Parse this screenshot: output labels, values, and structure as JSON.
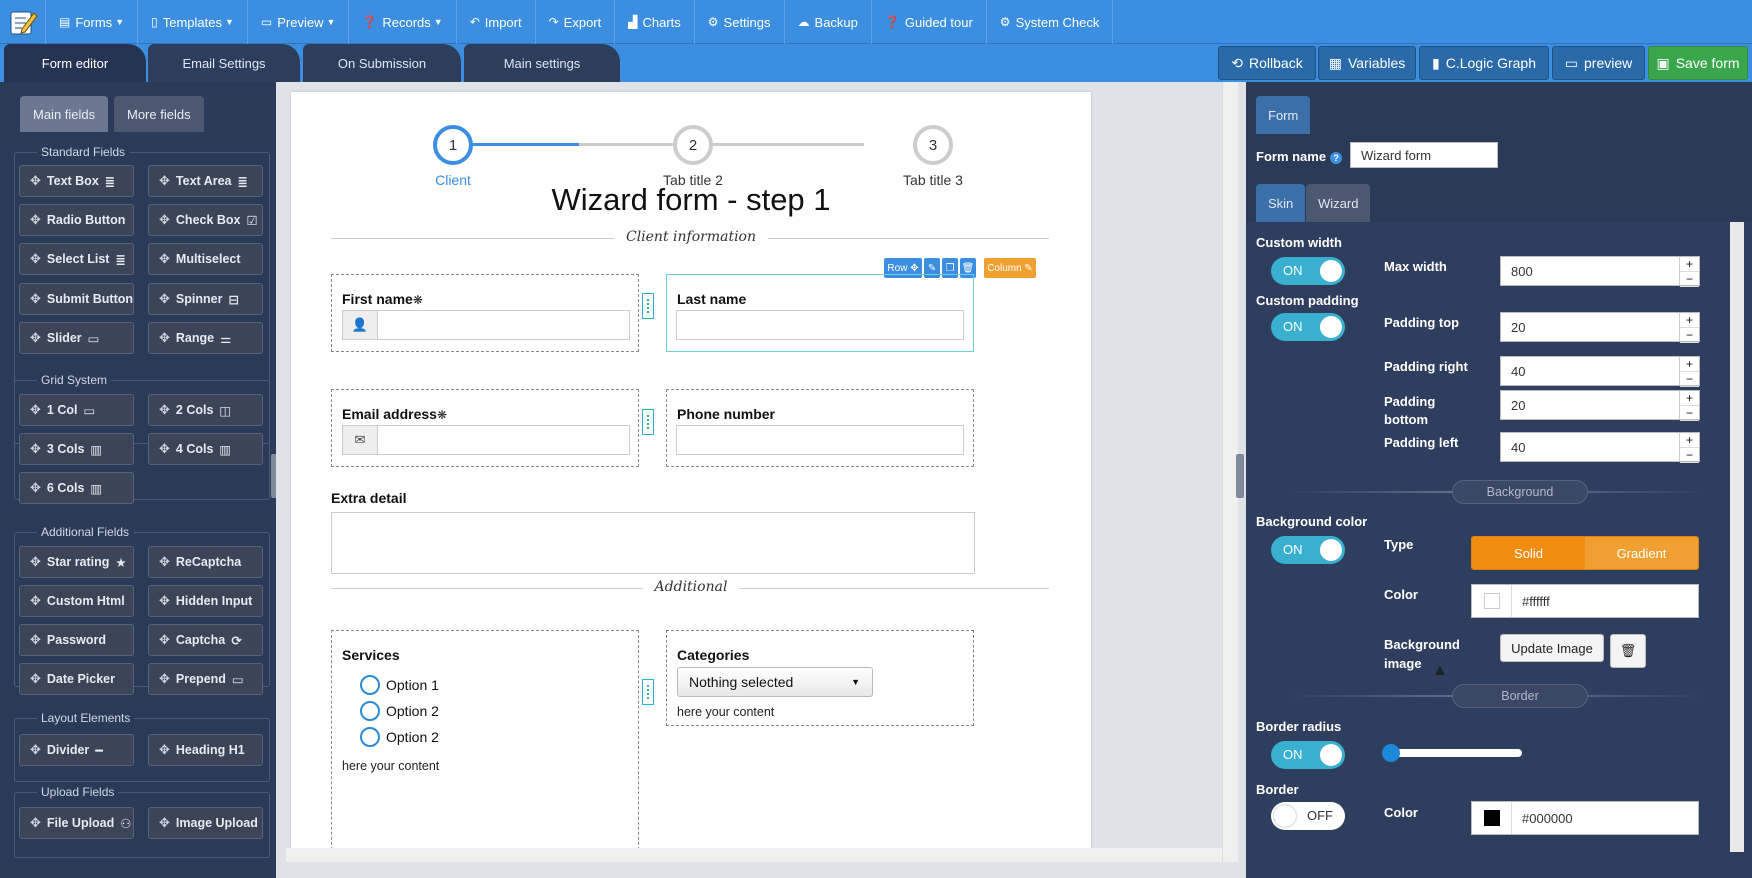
{
  "topnav": {
    "items": [
      {
        "label": "Forms",
        "icon": "file-icon",
        "caret": true
      },
      {
        "label": "Templates",
        "icon": "template-icon",
        "caret": true
      },
      {
        "label": "Preview",
        "icon": "monitor-icon",
        "caret": true
      },
      {
        "label": "Records",
        "icon": "question-icon",
        "caret": true
      },
      {
        "label": "Import",
        "icon": "undo-icon",
        "caret": false
      },
      {
        "label": "Export",
        "icon": "share-icon",
        "caret": false
      },
      {
        "label": "Charts",
        "icon": "chart-icon",
        "caret": false
      },
      {
        "label": "Settings",
        "icon": "gear-icon",
        "caret": false
      },
      {
        "label": "Backup",
        "icon": "cloud-icon",
        "caret": false
      },
      {
        "label": "Guided tour",
        "icon": "question-icon",
        "caret": false
      },
      {
        "label": "System Check",
        "icon": "gear-icon",
        "caret": false
      }
    ]
  },
  "editor_tabs": [
    "Form editor",
    "Email Settings",
    "On Submission",
    "Main settings"
  ],
  "actions": {
    "rollback": "Rollback",
    "variables": "Variables",
    "clogic": "C.Logic Graph",
    "preview": "preview",
    "save": "Save form"
  },
  "left": {
    "tabs": [
      "Main fields",
      "More fields"
    ],
    "groups": {
      "standard": {
        "caption": "Standard Fields",
        "items": [
          "Text Box",
          "Text Area",
          "Radio Button",
          "Check Box",
          "Select List",
          "Multiselect",
          "Submit Button",
          "Spinner",
          "Slider",
          "Range"
        ]
      },
      "grid": {
        "caption": "Grid System",
        "items": [
          "1 Col",
          "2 Cols",
          "3 Cols",
          "4 Cols",
          "6 Cols"
        ]
      },
      "additional": {
        "caption": "Additional Fields",
        "items": [
          "Star rating",
          "ReCaptcha",
          "Custom Html",
          "Hidden Input",
          "Password",
          "Captcha",
          "Date Picker",
          "Prepend"
        ]
      },
      "layout": {
        "caption": "Layout Elements",
        "items": [
          "Divider",
          "Heading H1"
        ]
      },
      "upload": {
        "caption": "Upload Fields",
        "items": [
          "File Upload",
          "Image Upload"
        ]
      }
    }
  },
  "form": {
    "steps": [
      {
        "num": "1",
        "label": "Client"
      },
      {
        "num": "2",
        "label": "Tab title 2"
      },
      {
        "num": "3",
        "label": "Tab title 3"
      }
    ],
    "title": "Wizard form - step 1",
    "div1": "Client information",
    "first_name": "First name",
    "last_name": "Last name",
    "email": "Email address",
    "phone": "Phone number",
    "extra": "Extra detail",
    "div2": "Additional",
    "services": "Services",
    "options": [
      "Option 1",
      "Option 2",
      "Option 2"
    ],
    "services_help": "here your content",
    "categories": "Categories",
    "categories_value": "Nothing selected",
    "categories_help": "here your content",
    "row_tool": "Row",
    "col_tool": "Column",
    "required_mark": "❋"
  },
  "right": {
    "tab": "Form",
    "form_name_label": "Form name",
    "form_name_value": "Wizard form",
    "subtabs": [
      "Skin",
      "Wizard"
    ],
    "custom_width": "Custom width",
    "custom_padding": "Custom padding",
    "toggle_on": "ON",
    "toggle_off": "OFF",
    "max_width_label": "Max width",
    "max_width": "800",
    "padding_top_label": "Padding top",
    "padding_top": "20",
    "padding_right_label": "Padding right",
    "padding_right": "40",
    "padding_bottom_label": "Padding bottom",
    "padding_bottom": "20",
    "padding_left_label": "Padding left",
    "padding_left": "40",
    "background_section": "Background",
    "bg_color_label": "Background color",
    "type_label": "Type",
    "type_solid": "Solid",
    "type_gradient": "Gradient",
    "color_label": "Color",
    "bg_color_value": "#ffffff",
    "bg_image_label": "Background image",
    "update_image": "Update Image",
    "border_section": "Border",
    "border_radius_label": "Border radius",
    "border_label": "Border",
    "border_color_label": "Color",
    "border_color_value": "#000000",
    "border_radius_level": 0
  },
  "colors": {
    "accent": "#3c8fe0",
    "panel": "#2b3a57",
    "orange": "#f0a030",
    "green": "#3aa64b",
    "toggle": "#3ab0d0"
  }
}
